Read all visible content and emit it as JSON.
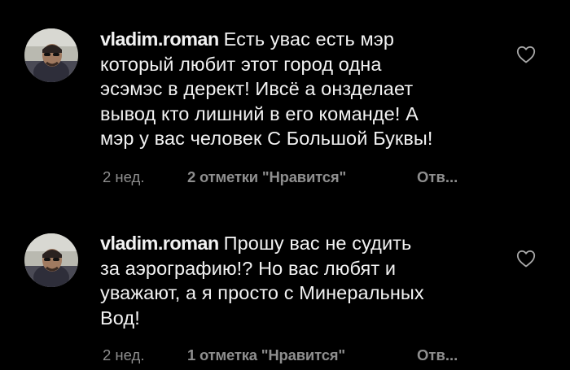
{
  "comments": [
    {
      "username": "vladim.roman",
      "text_lines": [
        "Есть увас есть мэр",
        "который любит этот город одна",
        "эсэмэс в дерект! Ивсё а онзделает",
        "вывод кто лишний в его команде! А",
        "мэр у вас человек С Большой Буквы!"
      ],
      "time": "2 нед.",
      "likes": "2 отметки \"Нравится\"",
      "reply": "Отв...",
      "avatar_icon": "user-avatar",
      "like_icon": "heart-outline-icon"
    },
    {
      "username": "vladim.roman",
      "text_lines": [
        "Прошу вас не судить",
        "за аэрографию!? Но вас любят и",
        "уважают, а я просто с Минеральных",
        "Вод!"
      ],
      "time": "2 нед.",
      "likes": "1 отметка \"Нравится\"",
      "reply": "Отв...",
      "avatar_icon": "user-avatar",
      "like_icon": "heart-outline-icon"
    }
  ],
  "colors": {
    "background": "#000000",
    "text": "#f2f2f2",
    "meta": "#8e8e8e"
  }
}
